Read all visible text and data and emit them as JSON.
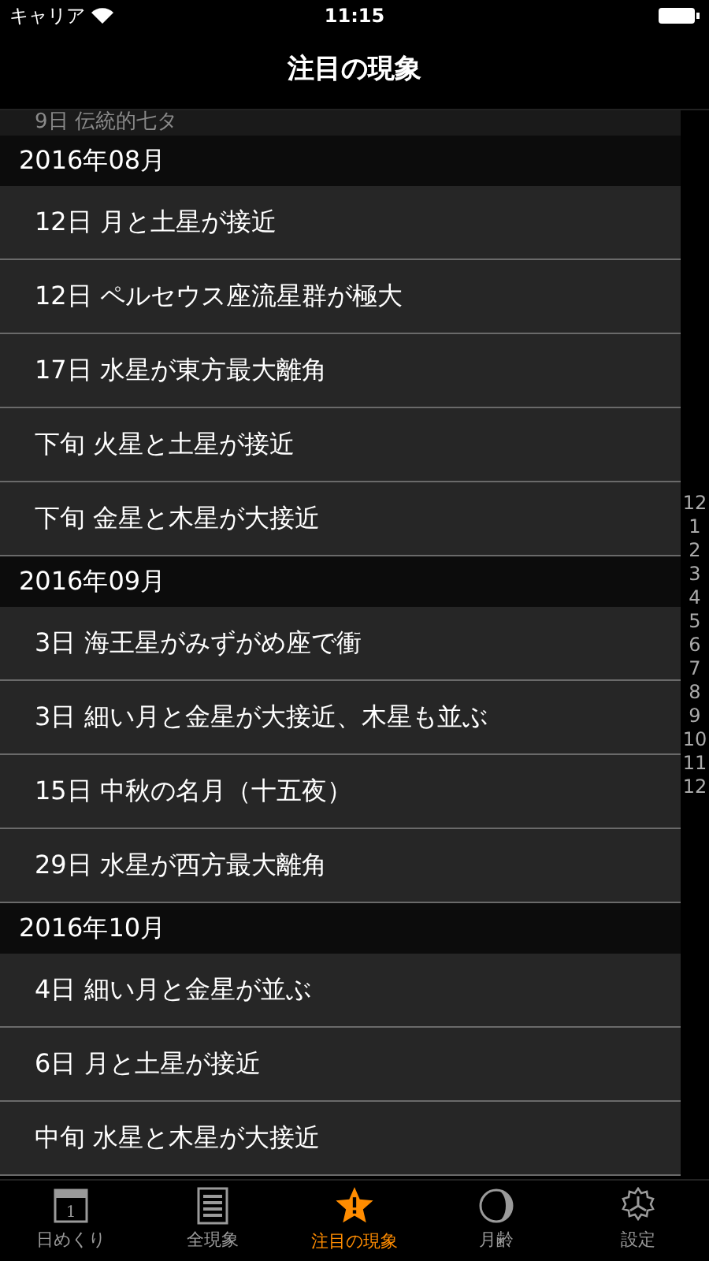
{
  "status_bar": {
    "carrier": "キャリア",
    "time": "11:15"
  },
  "nav": {
    "title": "注目の現象"
  },
  "hidden_row": "9日 伝統的七タ",
  "sections": [
    {
      "title": "2016年08月",
      "rows": [
        "12日 月と土星が接近",
        "12日 ペルセウス座流星群が極大",
        "17日 水星が東方最大離角",
        "下旬 火星と土星が接近",
        "下旬 金星と木星が大接近"
      ]
    },
    {
      "title": "2016年09月",
      "rows": [
        "3日 海王星がみずがめ座で衝",
        "3日 細い月と金星が大接近、木星も並ぶ",
        "15日 中秋の名月（十五夜）",
        "29日 水星が西方最大離角"
      ]
    },
    {
      "title": "2016年10月",
      "rows": [
        "4日 細い月と金星が並ぶ",
        "6日 月と土星が接近",
        "中旬 水星と木星が大接近"
      ]
    }
  ],
  "index": [
    "12",
    "1",
    "2",
    "3",
    "4",
    "5",
    "6",
    "7",
    "8",
    "9",
    "10",
    "11",
    "12"
  ],
  "tabs": [
    {
      "kind": "calendar",
      "label": "日めくり",
      "selected": false,
      "icon_text": "1"
    },
    {
      "kind": "list",
      "label": "全現象",
      "selected": false
    },
    {
      "kind": "star",
      "label": "注目の現象",
      "selected": true
    },
    {
      "kind": "moon",
      "label": "月齢",
      "selected": false
    },
    {
      "kind": "gear",
      "label": "設定",
      "selected": false
    }
  ]
}
